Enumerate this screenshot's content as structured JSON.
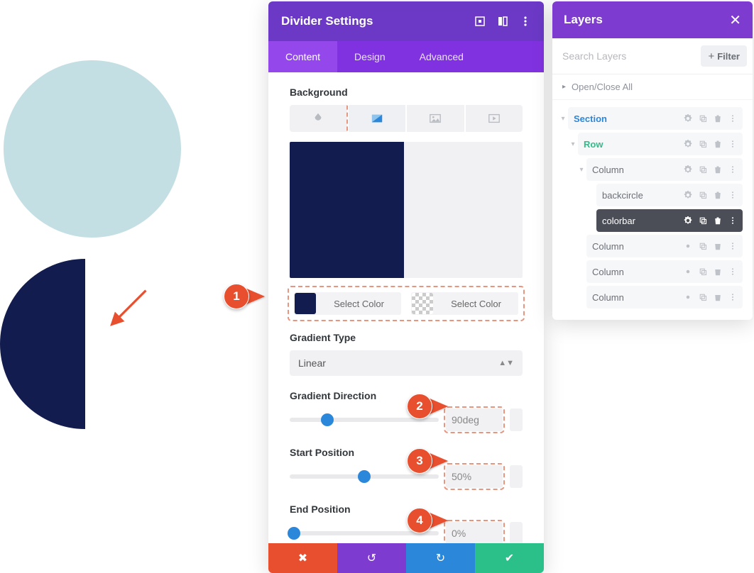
{
  "panel": {
    "title": "Divider Settings",
    "tabs": {
      "content": "Content",
      "design": "Design",
      "advanced": "Advanced"
    },
    "background_label": "Background",
    "select_color": "Select Color",
    "gradient_type_label": "Gradient Type",
    "gradient_type_value": "Linear",
    "gradient_direction_label": "Gradient Direction",
    "gradient_direction_value": "90deg",
    "start_position_label": "Start Position",
    "start_position_value": "50%",
    "end_position_label": "End Position",
    "end_position_value": "0%"
  },
  "colors": {
    "primary": "#131c4e",
    "accent": "#e84f2e",
    "brand": "#7e3bd0"
  },
  "callouts": {
    "c1": "1",
    "c2": "2",
    "c3": "3",
    "c4": "4"
  },
  "layers": {
    "title": "Layers",
    "search_placeholder": "Search Layers",
    "filter": "Filter",
    "open_close": "Open/Close All",
    "tree": {
      "section": "Section",
      "row": "Row",
      "col": "Column",
      "backcircle": "backcircle",
      "colorbar": "colorbar"
    }
  }
}
